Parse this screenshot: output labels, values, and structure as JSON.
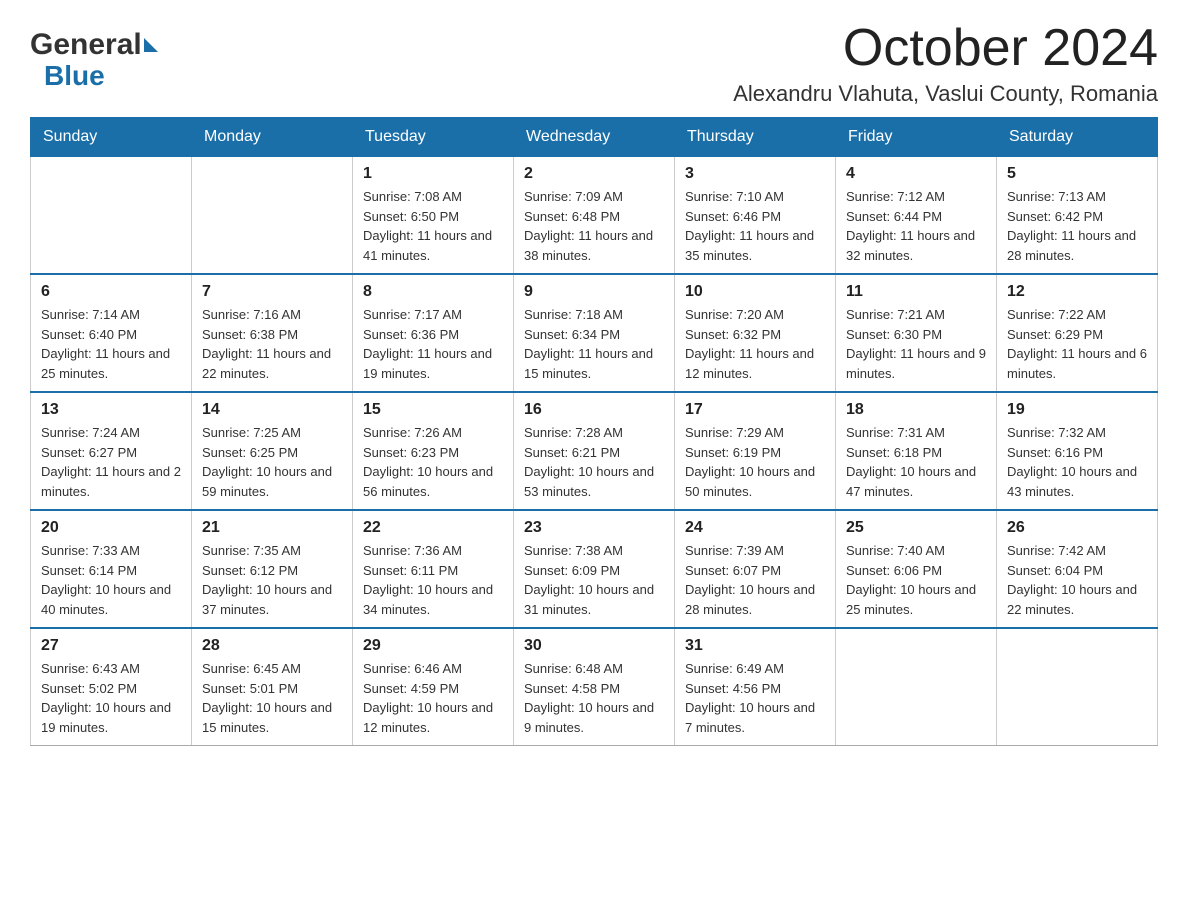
{
  "logo": {
    "general": "General",
    "blue": "Blue"
  },
  "title": {
    "month": "October 2024",
    "location": "Alexandru Vlahuta, Vaslui County, Romania"
  },
  "headers": [
    "Sunday",
    "Monday",
    "Tuesday",
    "Wednesday",
    "Thursday",
    "Friday",
    "Saturday"
  ],
  "weeks": [
    [
      {
        "day": "",
        "sunrise": "",
        "sunset": "",
        "daylight": ""
      },
      {
        "day": "",
        "sunrise": "",
        "sunset": "",
        "daylight": ""
      },
      {
        "day": "1",
        "sunrise": "Sunrise: 7:08 AM",
        "sunset": "Sunset: 6:50 PM",
        "daylight": "Daylight: 11 hours and 41 minutes."
      },
      {
        "day": "2",
        "sunrise": "Sunrise: 7:09 AM",
        "sunset": "Sunset: 6:48 PM",
        "daylight": "Daylight: 11 hours and 38 minutes."
      },
      {
        "day": "3",
        "sunrise": "Sunrise: 7:10 AM",
        "sunset": "Sunset: 6:46 PM",
        "daylight": "Daylight: 11 hours and 35 minutes."
      },
      {
        "day": "4",
        "sunrise": "Sunrise: 7:12 AM",
        "sunset": "Sunset: 6:44 PM",
        "daylight": "Daylight: 11 hours and 32 minutes."
      },
      {
        "day": "5",
        "sunrise": "Sunrise: 7:13 AM",
        "sunset": "Sunset: 6:42 PM",
        "daylight": "Daylight: 11 hours and 28 minutes."
      }
    ],
    [
      {
        "day": "6",
        "sunrise": "Sunrise: 7:14 AM",
        "sunset": "Sunset: 6:40 PM",
        "daylight": "Daylight: 11 hours and 25 minutes."
      },
      {
        "day": "7",
        "sunrise": "Sunrise: 7:16 AM",
        "sunset": "Sunset: 6:38 PM",
        "daylight": "Daylight: 11 hours and 22 minutes."
      },
      {
        "day": "8",
        "sunrise": "Sunrise: 7:17 AM",
        "sunset": "Sunset: 6:36 PM",
        "daylight": "Daylight: 11 hours and 19 minutes."
      },
      {
        "day": "9",
        "sunrise": "Sunrise: 7:18 AM",
        "sunset": "Sunset: 6:34 PM",
        "daylight": "Daylight: 11 hours and 15 minutes."
      },
      {
        "day": "10",
        "sunrise": "Sunrise: 7:20 AM",
        "sunset": "Sunset: 6:32 PM",
        "daylight": "Daylight: 11 hours and 12 minutes."
      },
      {
        "day": "11",
        "sunrise": "Sunrise: 7:21 AM",
        "sunset": "Sunset: 6:30 PM",
        "daylight": "Daylight: 11 hours and 9 minutes."
      },
      {
        "day": "12",
        "sunrise": "Sunrise: 7:22 AM",
        "sunset": "Sunset: 6:29 PM",
        "daylight": "Daylight: 11 hours and 6 minutes."
      }
    ],
    [
      {
        "day": "13",
        "sunrise": "Sunrise: 7:24 AM",
        "sunset": "Sunset: 6:27 PM",
        "daylight": "Daylight: 11 hours and 2 minutes."
      },
      {
        "day": "14",
        "sunrise": "Sunrise: 7:25 AM",
        "sunset": "Sunset: 6:25 PM",
        "daylight": "Daylight: 10 hours and 59 minutes."
      },
      {
        "day": "15",
        "sunrise": "Sunrise: 7:26 AM",
        "sunset": "Sunset: 6:23 PM",
        "daylight": "Daylight: 10 hours and 56 minutes."
      },
      {
        "day": "16",
        "sunrise": "Sunrise: 7:28 AM",
        "sunset": "Sunset: 6:21 PM",
        "daylight": "Daylight: 10 hours and 53 minutes."
      },
      {
        "day": "17",
        "sunrise": "Sunrise: 7:29 AM",
        "sunset": "Sunset: 6:19 PM",
        "daylight": "Daylight: 10 hours and 50 minutes."
      },
      {
        "day": "18",
        "sunrise": "Sunrise: 7:31 AM",
        "sunset": "Sunset: 6:18 PM",
        "daylight": "Daylight: 10 hours and 47 minutes."
      },
      {
        "day": "19",
        "sunrise": "Sunrise: 7:32 AM",
        "sunset": "Sunset: 6:16 PM",
        "daylight": "Daylight: 10 hours and 43 minutes."
      }
    ],
    [
      {
        "day": "20",
        "sunrise": "Sunrise: 7:33 AM",
        "sunset": "Sunset: 6:14 PM",
        "daylight": "Daylight: 10 hours and 40 minutes."
      },
      {
        "day": "21",
        "sunrise": "Sunrise: 7:35 AM",
        "sunset": "Sunset: 6:12 PM",
        "daylight": "Daylight: 10 hours and 37 minutes."
      },
      {
        "day": "22",
        "sunrise": "Sunrise: 7:36 AM",
        "sunset": "Sunset: 6:11 PM",
        "daylight": "Daylight: 10 hours and 34 minutes."
      },
      {
        "day": "23",
        "sunrise": "Sunrise: 7:38 AM",
        "sunset": "Sunset: 6:09 PM",
        "daylight": "Daylight: 10 hours and 31 minutes."
      },
      {
        "day": "24",
        "sunrise": "Sunrise: 7:39 AM",
        "sunset": "Sunset: 6:07 PM",
        "daylight": "Daylight: 10 hours and 28 minutes."
      },
      {
        "day": "25",
        "sunrise": "Sunrise: 7:40 AM",
        "sunset": "Sunset: 6:06 PM",
        "daylight": "Daylight: 10 hours and 25 minutes."
      },
      {
        "day": "26",
        "sunrise": "Sunrise: 7:42 AM",
        "sunset": "Sunset: 6:04 PM",
        "daylight": "Daylight: 10 hours and 22 minutes."
      }
    ],
    [
      {
        "day": "27",
        "sunrise": "Sunrise: 6:43 AM",
        "sunset": "Sunset: 5:02 PM",
        "daylight": "Daylight: 10 hours and 19 minutes."
      },
      {
        "day": "28",
        "sunrise": "Sunrise: 6:45 AM",
        "sunset": "Sunset: 5:01 PM",
        "daylight": "Daylight: 10 hours and 15 minutes."
      },
      {
        "day": "29",
        "sunrise": "Sunrise: 6:46 AM",
        "sunset": "Sunset: 4:59 PM",
        "daylight": "Daylight: 10 hours and 12 minutes."
      },
      {
        "day": "30",
        "sunrise": "Sunrise: 6:48 AM",
        "sunset": "Sunset: 4:58 PM",
        "daylight": "Daylight: 10 hours and 9 minutes."
      },
      {
        "day": "31",
        "sunrise": "Sunrise: 6:49 AM",
        "sunset": "Sunset: 4:56 PM",
        "daylight": "Daylight: 10 hours and 7 minutes."
      },
      {
        "day": "",
        "sunrise": "",
        "sunset": "",
        "daylight": ""
      },
      {
        "day": "",
        "sunrise": "",
        "sunset": "",
        "daylight": ""
      }
    ]
  ]
}
